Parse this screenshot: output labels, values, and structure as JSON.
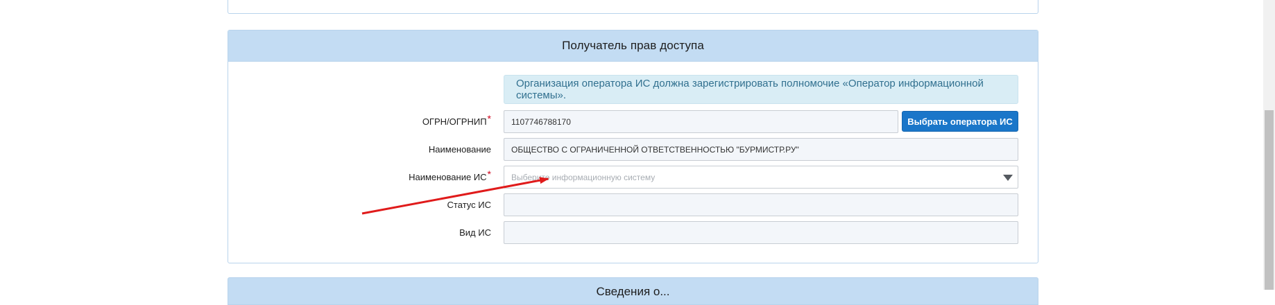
{
  "section": {
    "title": "Получатель прав доступа",
    "next_title": "Сведения о..."
  },
  "info": {
    "text": "Организация оператора ИС должна зарегистрировать полномочие «Оператор информационной системы»."
  },
  "form": {
    "ogrn": {
      "label": "ОГРН/ОГРНИП",
      "required": "*",
      "value": "1107746788170",
      "button_label": "Выбрать оператора ИС"
    },
    "name": {
      "label": "Наименование",
      "value": "ОБЩЕСТВО С ОГРАНИЧЕННОЙ ОТВЕТСТВЕННОСТЬЮ \"БУРМИСТР.РУ\""
    },
    "is_name": {
      "label": "Наименование ИС",
      "required": "*",
      "placeholder": "Выберите информационную систему"
    },
    "is_status": {
      "label": "Статус ИС",
      "value": ""
    },
    "is_kind": {
      "label": "Вид ИС",
      "value": ""
    }
  },
  "annotation": {
    "arrow_color": "#e01b1b"
  }
}
